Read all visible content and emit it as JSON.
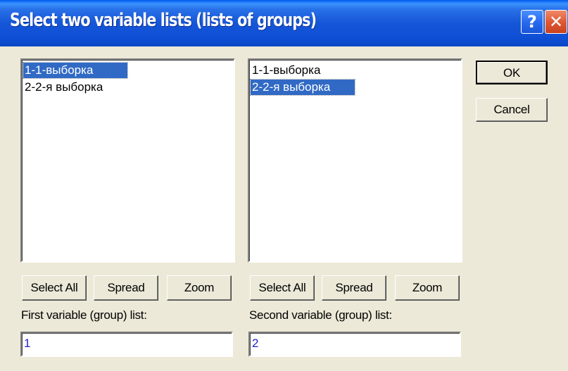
{
  "window": {
    "title": "Select two variable lists (lists of groups)",
    "help_glyph": "?",
    "close_glyph": "✕"
  },
  "first_list": {
    "items": [
      {
        "label": "1-1-выборка",
        "selected": true
      },
      {
        "label": "2-2-я выборка",
        "selected": false
      }
    ],
    "select_all_label": "Select All",
    "spread_label": "Spread",
    "zoom_label": "Zoom",
    "field_label": "First variable (group) list:",
    "field_value": "1"
  },
  "second_list": {
    "items": [
      {
        "label": "1-1-выборка",
        "selected": false
      },
      {
        "label": "2-2-я выборка",
        "selected": true
      }
    ],
    "select_all_label": "Select All",
    "spread_label": "Spread",
    "zoom_label": "Zoom",
    "field_label": "Second variable (group) list:",
    "field_value": "2"
  },
  "dialog_buttons": {
    "ok_label": "OK",
    "cancel_label": "Cancel"
  },
  "colors": {
    "titlebar": "#1556d8",
    "selection": "#316ac5",
    "dialog_face": "#ece9d8",
    "field_text": "#2222cc"
  }
}
